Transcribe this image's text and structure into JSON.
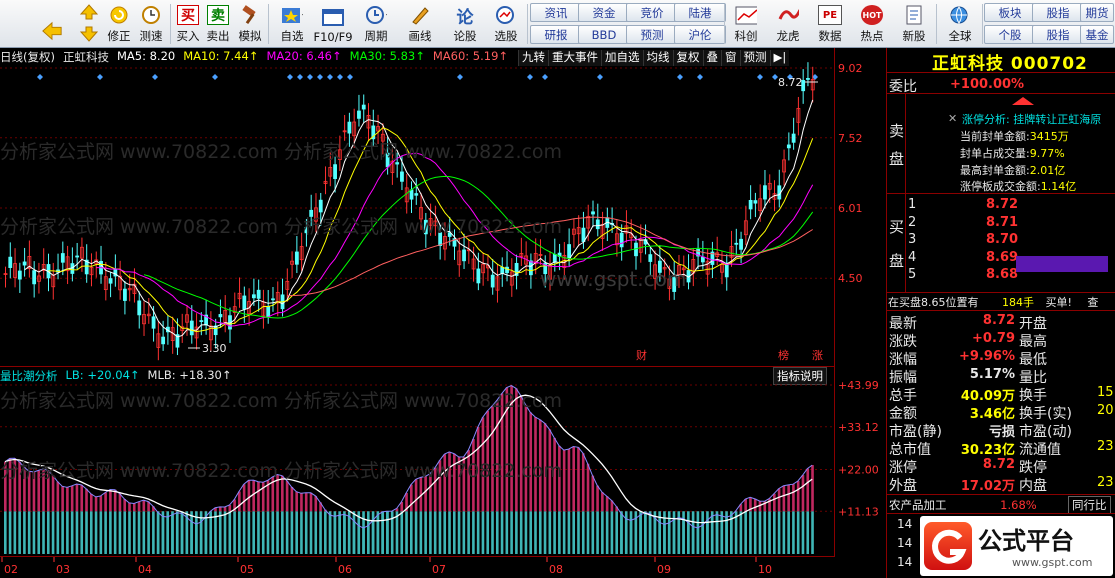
{
  "toolbar": {
    "buttons": [
      {
        "label": "修正",
        "icon": "refresh-icon"
      },
      {
        "label": "测速",
        "icon": "clock-icon"
      },
      {
        "label": "买入",
        "icon": "buy-icon",
        "glyph": "买"
      },
      {
        "label": "卖出",
        "icon": "sell-icon",
        "glyph": "卖"
      },
      {
        "label": "模拟",
        "icon": "hammer-icon"
      },
      {
        "label": "自选",
        "icon": "star-folder-icon"
      },
      {
        "label": "F10/F9",
        "icon": "window-icon"
      },
      {
        "label": "周期",
        "icon": "cycle-icon"
      },
      {
        "label": "画线",
        "icon": "pencil-icon"
      },
      {
        "label": "论股",
        "icon": "discuss-icon",
        "glyph": "论"
      },
      {
        "label": "选股",
        "icon": "select-stock-icon"
      }
    ],
    "grid_buttons": [
      "资讯",
      "资金",
      "竞价",
      "陆港",
      "研报",
      "BBD",
      "预测",
      "沪伦"
    ],
    "buttons2": [
      {
        "label": "科创",
        "icon": "chart-window-icon"
      },
      {
        "label": "龙虎",
        "icon": "dragon-icon"
      },
      {
        "label": "数据",
        "icon": "pe-icon",
        "glyph": "PE"
      },
      {
        "label": "热点",
        "icon": "hot-icon",
        "glyph": "HOT"
      },
      {
        "label": "新股",
        "icon": "new-stock-icon"
      },
      {
        "label": "全球",
        "icon": "globe-icon"
      }
    ],
    "grid_buttons2": [
      "板块",
      "股指",
      "期货",
      "个股",
      "股指",
      "基金"
    ]
  },
  "chart": {
    "title": "日线(复权)",
    "stock_name": "正虹科技",
    "ma": [
      {
        "label": "MA5: 8.20",
        "color": "#ffffff"
      },
      {
        "label": "MA10: 7.44↑",
        "color": "#ffff00"
      },
      {
        "label": "MA20: 6.46↑",
        "color": "#ff00ff"
      },
      {
        "label": "MA30: 5.83↑",
        "color": "#00ff00"
      },
      {
        "label": "MA60: 5.19↑",
        "color": "#ff6060"
      }
    ],
    "tabs": [
      "九转",
      "重大事件",
      "加自选",
      "均线",
      "复权",
      "叠",
      "窗",
      "预测",
      "▶|",
      "涨"
    ],
    "price_axis": [
      "9.02",
      "7.52",
      "6.01",
      "4.50"
    ],
    "high_label": "8.72",
    "low_label": "3.30",
    "markers": [
      "财",
      "榜",
      "涨"
    ],
    "indicator_title": "量比潮分析",
    "indicator_lb": "LB: +20.04↑",
    "indicator_mlb": "MLB: +18.30↑",
    "indicator_button": "指标说明",
    "ind_axis": [
      "+43.99",
      "+33.12",
      "+22.00",
      "+11.13"
    ],
    "months": [
      "02",
      "03",
      "04",
      "05",
      "06",
      "07",
      "08",
      "09",
      "10"
    ],
    "watermark": "分析家公式网 www.70822.com",
    "watermark2": "www.gspt.com"
  },
  "chart_data": {
    "type": "line",
    "title": "正虹科技",
    "x": [
      "02",
      "03",
      "04",
      "05",
      "06",
      "07",
      "08",
      "09",
      "10"
    ],
    "series": [
      {
        "name": "MA5",
        "values": [
          4.7,
          4.6,
          4.3,
          5.7,
          7.0,
          5.0,
          5.0,
          4.8,
          8.2
        ]
      },
      {
        "name": "MA10",
        "values": [
          4.7,
          4.6,
          4.3,
          5.4,
          6.6,
          5.2,
          5.1,
          4.8,
          7.44
        ]
      },
      {
        "name": "MA60",
        "values": [
          4.9,
          4.8,
          4.6,
          4.8,
          5.6,
          5.4,
          5.1,
          4.9,
          5.19
        ]
      }
    ],
    "ylim": [
      3.0,
      9.02
    ],
    "high": 8.72,
    "low": 3.3
  },
  "side": {
    "title": "正虹科技 000702",
    "weibi_label": "委比",
    "weibi_value": "+100.00%",
    "sell_label": [
      "卖",
      "盘"
    ],
    "buy_label": [
      "买",
      "盘"
    ],
    "limit_analysis": "涨停分析: 挂牌转让正虹海原",
    "limit_rows": [
      {
        "label": "当前封单金额:",
        "value": "3415万"
      },
      {
        "label": "封单占成交量:",
        "value": "9.77%"
      },
      {
        "label": "最高封单金额:",
        "value": "2.01亿"
      },
      {
        "label": "涨停板成交金额:",
        "value": "1.14亿"
      }
    ],
    "buy_levels": [
      {
        "n": "1",
        "price": "8.72"
      },
      {
        "n": "2",
        "price": "8.71"
      },
      {
        "n": "3",
        "price": "8.70"
      },
      {
        "n": "4",
        "price": "8.69"
      },
      {
        "n": "5",
        "price": "8.68"
      }
    ],
    "in_buy": "在买盘8.65位置有",
    "in_buy_qty": "184手",
    "in_buy_tail": "买单!",
    "in_buy_more": "查",
    "quote": [
      {
        "l": "最新",
        "v": "8.72",
        "vc": "#ff3232",
        "l2": "开盘",
        "v2": ""
      },
      {
        "l": "涨跌",
        "v": "+0.79",
        "vc": "#ff3232",
        "l2": "最高",
        "v2": ""
      },
      {
        "l": "涨幅",
        "v": "+9.96%",
        "vc": "#ff3232",
        "l2": "最低",
        "v2": ""
      },
      {
        "l": "振幅",
        "v": "5.17%",
        "vc": "#e8e8e8",
        "l2": "量比",
        "v2": ""
      },
      {
        "l": "总手",
        "v": "40.09万",
        "vc": "#ffff00",
        "l2": "换手",
        "v2": "15"
      },
      {
        "l": "金额",
        "v": "3.46亿",
        "vc": "#ffff00",
        "l2": "换手(实)",
        "v2": "20"
      },
      {
        "l": "市盈(静)",
        "v": "亏损",
        "vc": "#e8e8e8",
        "l2": "市盈(动)",
        "v2": ""
      },
      {
        "l": "总市值",
        "v": "30.23亿",
        "vc": "#ffff00",
        "l2": "流通值",
        "v2": "23"
      },
      {
        "l": "涨停",
        "v": "8.72",
        "vc": "#ff3232",
        "l2": "跌停",
        "v2": ""
      },
      {
        "l": "外盘",
        "v": "17.02万",
        "vc": "#ff3232",
        "l2": "内盘",
        "v2": "23"
      }
    ],
    "sector": "农产品加工",
    "sector_pct": "1.68%",
    "peer": "同行比",
    "bottom_rows": [
      "14",
      "14",
      "14"
    ],
    "logo_text": "公式平台",
    "logo_url": "www.gspt.com"
  }
}
